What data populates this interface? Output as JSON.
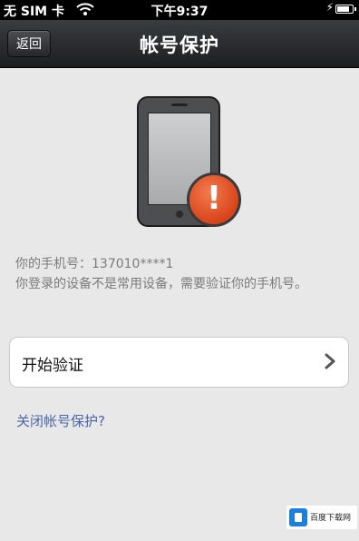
{
  "status_bar": {
    "carrier": "无 SIM 卡",
    "time": "下午9:37",
    "battery_level": 0.85
  },
  "nav": {
    "back_label": "返回",
    "title": "帐号保护"
  },
  "illustration": {
    "phone_icon": "phone-icon",
    "warning_icon": "warning-icon",
    "warning_glyph": "!",
    "warning_color": "#e0541f"
  },
  "message": {
    "line1": "你的手机号：137010****1",
    "line2": "你登录的设备不是常用设备，需要验证你的手机号。"
  },
  "verify_row": {
    "label": "开始验证",
    "icon": "chevron-right-icon"
  },
  "close_link": "关闭帐号保护?",
  "colors": {
    "navbar": "#2b2e30",
    "background": "#e8e8e9",
    "link": "#4a66a8"
  }
}
